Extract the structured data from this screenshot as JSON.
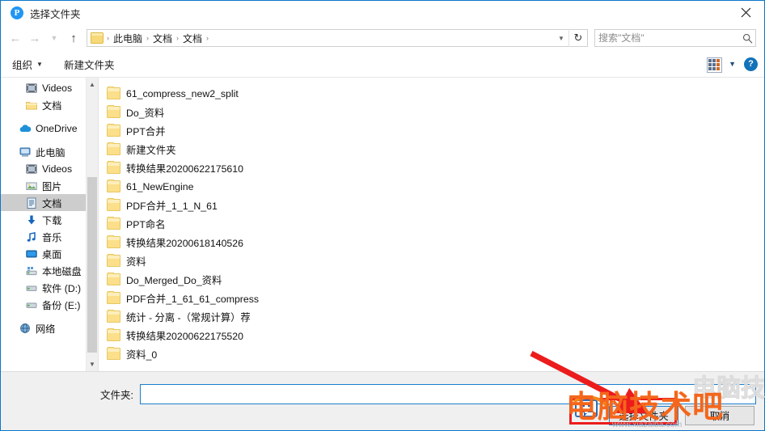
{
  "window": {
    "title": "选择文件夹",
    "app_icon": "P",
    "close_icon": "close-icon",
    "accent": "#0a76c8"
  },
  "address": {
    "back_icon": "back-arrow-icon",
    "forward_icon": "forward-arrow-icon",
    "history_icon": "chevron-down-icon",
    "up_icon": "up-arrow-icon",
    "folder_icon": "folder-icon",
    "crumbs": [
      "此电脑",
      "文档",
      "文档"
    ],
    "separator": "›",
    "dropdown_icon": "chevron-down-icon",
    "refresh_icon": "refresh-icon",
    "refresh_glyph": "↻"
  },
  "search": {
    "placeholder": "搜索\"文档\"",
    "value": "",
    "icon": "search-icon"
  },
  "commandbar": {
    "organize": "组织",
    "new_folder": "新建文件夹",
    "caret": "▼",
    "view_icon": "view-grid-icon",
    "view_caret": "▼",
    "help_label": "?"
  },
  "sidebar": {
    "items": [
      {
        "label": "Videos",
        "icon": "videos-icon",
        "indent": 2,
        "selected": false,
        "gap_before": false
      },
      {
        "label": "文档",
        "icon": "folder-icon",
        "indent": 2,
        "selected": false,
        "gap_before": false
      },
      {
        "label": "OneDrive",
        "icon": "onedrive-icon",
        "indent": 1,
        "selected": false,
        "gap_before": true
      },
      {
        "label": "此电脑",
        "icon": "computer-icon",
        "indent": 1,
        "selected": false,
        "gap_before": true
      },
      {
        "label": "Videos",
        "icon": "videos-icon",
        "indent": 2,
        "selected": false,
        "gap_before": false
      },
      {
        "label": "图片",
        "icon": "pictures-icon",
        "indent": 2,
        "selected": false,
        "gap_before": false
      },
      {
        "label": "文档",
        "icon": "documents-icon",
        "indent": 2,
        "selected": true,
        "gap_before": false
      },
      {
        "label": "下载",
        "icon": "downloads-icon",
        "indent": 2,
        "selected": false,
        "gap_before": false
      },
      {
        "label": "音乐",
        "icon": "music-icon",
        "indent": 2,
        "selected": false,
        "gap_before": false
      },
      {
        "label": "桌面",
        "icon": "desktop-icon",
        "indent": 2,
        "selected": false,
        "gap_before": false
      },
      {
        "label": "本地磁盘",
        "icon": "local-disk-icon",
        "indent": 2,
        "selected": false,
        "gap_before": false
      },
      {
        "label": "软件 (D:)",
        "icon": "drive-icon",
        "indent": 2,
        "selected": false,
        "gap_before": false
      },
      {
        "label": "备份 (E:)",
        "icon": "drive-icon",
        "indent": 2,
        "selected": false,
        "gap_before": false
      },
      {
        "label": "网络",
        "icon": "network-icon",
        "indent": 1,
        "selected": false,
        "gap_before": true
      }
    ],
    "scroll_up_icon": "chevron-up-icon",
    "scroll_down_icon": "chevron-down-icon"
  },
  "files": [
    {
      "name": "61_compress_new2_split",
      "icon": "folder-icon"
    },
    {
      "name": "Do_资料",
      "icon": "folder-icon"
    },
    {
      "name": "PPT合并",
      "icon": "folder-icon"
    },
    {
      "name": "新建文件夹",
      "icon": "folder-icon"
    },
    {
      "name": "转换结果20200622175610",
      "icon": "folder-icon"
    },
    {
      "name": "61_NewEngine",
      "icon": "folder-icon"
    },
    {
      "name": "PDF合并_1_1_N_61",
      "icon": "folder-icon"
    },
    {
      "name": "PPT命名",
      "icon": "folder-icon"
    },
    {
      "name": "转换结果20200618140526",
      "icon": "folder-icon"
    },
    {
      "name": "资料",
      "icon": "folder-icon"
    },
    {
      "name": "Do_Merged_Do_资料",
      "icon": "folder-icon"
    },
    {
      "name": "PDF合并_1_61_61_compress",
      "icon": "folder-icon"
    },
    {
      "name": "统计 - 分离 -（常规计算）荐",
      "icon": "folder-icon"
    },
    {
      "name": "转换结果20200622175520",
      "icon": "folder-icon"
    },
    {
      "name": "资料_0",
      "icon": "folder-icon"
    }
  ],
  "footer": {
    "folder_label": "文件夹:",
    "folder_value": "",
    "select_button": "选择文件夹",
    "cancel_button": "取消"
  },
  "overlay": {
    "watermark_text": "电脑技术吧",
    "watermark_url": "www.xiazaiba.com",
    "arrow_icon": "red-arrow-icon",
    "highlight_icon": "red-highlight-box",
    "arrow_color": "#ec1c1c",
    "watermark_color": "#f4661b"
  }
}
